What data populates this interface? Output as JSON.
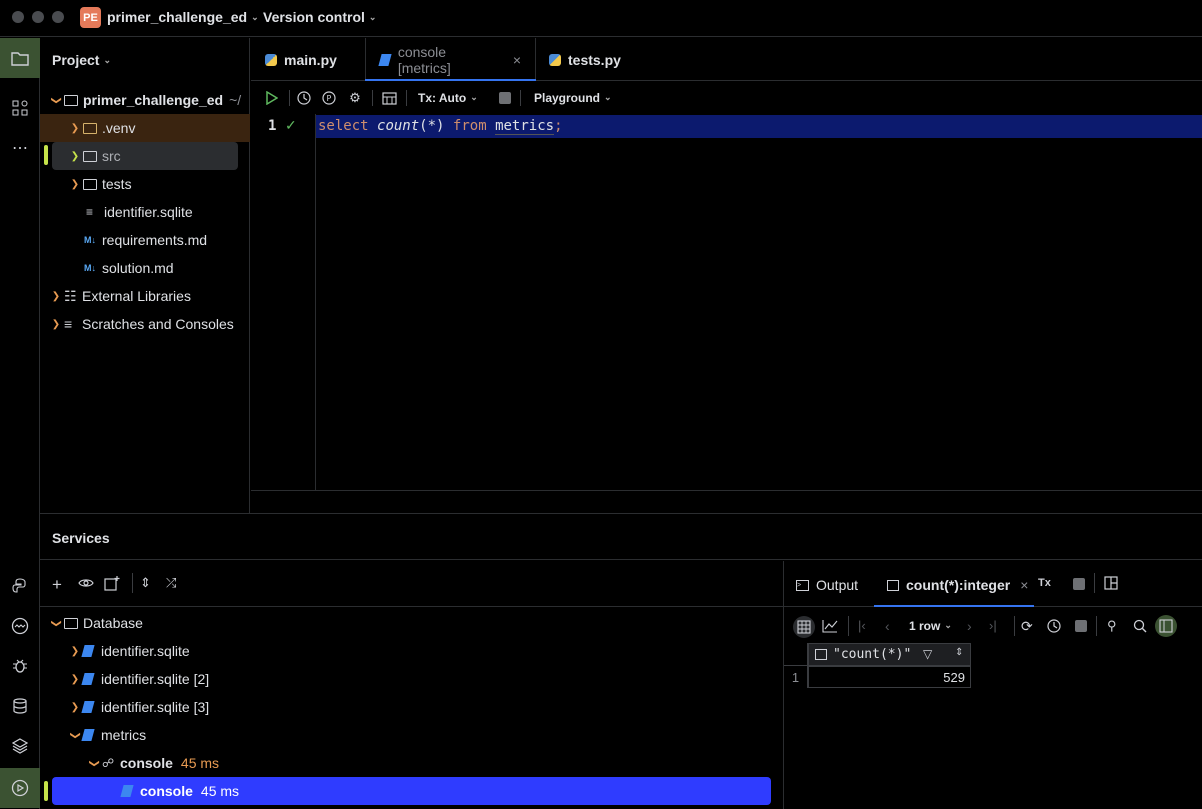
{
  "titlebar": {
    "project_badge": "PE",
    "project_name": "primer_challenge_ed",
    "vcs": "Version control"
  },
  "project_panel": {
    "header": "Project",
    "root_name": "primer_challenge_ed",
    "root_path": "~/",
    "items": [
      {
        "label": ".venv",
        "icon": "folder-icon"
      },
      {
        "label": "src",
        "icon": "source-folder-icon"
      },
      {
        "label": "tests",
        "icon": "test-folder-icon"
      },
      {
        "label": "identifier.sqlite",
        "icon": "text-file-icon"
      },
      {
        "label": "requirements.md",
        "icon": "markdown-icon"
      },
      {
        "label": "solution.md",
        "icon": "markdown-icon"
      },
      {
        "label": "External Libraries",
        "icon": "library-icon"
      },
      {
        "label": "Scratches and Consoles",
        "icon": "scratches-icon"
      }
    ],
    "md_badge": "M↓"
  },
  "editor": {
    "tabs": [
      {
        "label": "main.py"
      },
      {
        "label": "console [metrics]"
      },
      {
        "label": "tests.py"
      }
    ],
    "toolbar": {
      "tx_mode": "Tx: Auto",
      "playground": "Playground"
    },
    "line_number": "1",
    "code": {
      "kw_select": "select",
      "fn_count": "count",
      "paren_open": "(",
      "star": "*",
      "paren_close": ")",
      "kw_from": "from",
      "table": "metrics",
      "semicolon": ";"
    }
  },
  "services": {
    "title": "Services",
    "tree": {
      "root": "Database",
      "items": [
        {
          "label": "identifier.sqlite"
        },
        {
          "label": "identifier.sqlite [2]"
        },
        {
          "label": "identifier.sqlite [3]"
        },
        {
          "label": "metrics"
        }
      ],
      "console_group": {
        "label": "console",
        "time": "45 ms"
      },
      "console_selected": {
        "label": "console",
        "time": "45 ms"
      }
    },
    "results": {
      "tabs": [
        {
          "label": "Output"
        },
        {
          "label": "count(*):integer"
        }
      ],
      "tx_label": "Tx",
      "row_count": "1 row",
      "column_header": "\"count(*)\"",
      "row_number": "1",
      "value": "529"
    }
  },
  "colors": {
    "accent": "#2f3cff",
    "selected_line": "#0c1a6e",
    "keyword": "#cf8e6d",
    "warning": "#e89b52"
  }
}
